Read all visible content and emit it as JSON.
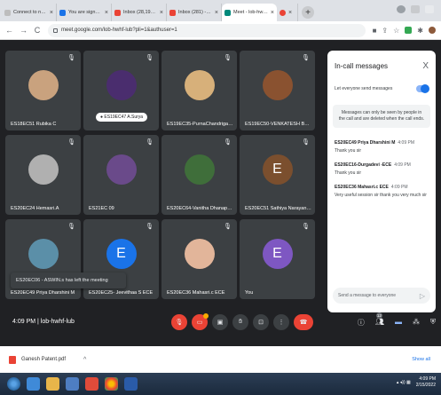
{
  "browser": {
    "tabs": [
      {
        "label": "Connect to network",
        "color": "#bdbdbd"
      },
      {
        "label": "You are signed in as es18ec17",
        "color": "#1a73e8"
      },
      {
        "label": "Inbox (28,199) - ",
        "color": "#ea4335"
      },
      {
        "label": "Inbox (281) - ecsy2@esec.ac.i",
        "color": "#ea4335"
      },
      {
        "label": "Meet - lob-hwhf-lub",
        "color": "#00897b"
      },
      {
        "label": "",
        "color": "#ea4335"
      }
    ],
    "url": "meet.google.com/lob-hwhf-lub?pli=1&authuser=1"
  },
  "participants": [
    {
      "name": "ES18EC51 Rubika C",
      "avatar_color": "#c9a27e",
      "letter": ""
    },
    {
      "name": "ES19EC47 A.Surya",
      "avatar_color": "#4a2d6e",
      "letter": "",
      "speaking": true
    },
    {
      "name": "ES19EC35-PurnaChandrigaa. R",
      "avatar_color": "#d7b07a",
      "letter": ""
    },
    {
      "name": "ES19EC50-VENKATESH BABU...",
      "avatar_color": "#8a5230",
      "letter": ""
    },
    {
      "name": "ES20EC24 Hemasri.A",
      "avatar_color": "#b0b0b0",
      "letter": ""
    },
    {
      "name": "ES21EC 09",
      "avatar_color": "#6a4a8a",
      "letter": ""
    },
    {
      "name": "ES20EC64-Vanitha Dhanapal ...",
      "avatar_color": "#3f6e3a",
      "letter": ""
    },
    {
      "name": "ES20EC51 Sathiya Narayanan t",
      "avatar_color": "#7b4f2e",
      "letter": "E"
    },
    {
      "name": "ES20EC49 Priya Dharshini M",
      "avatar_color": "#5b8fa8",
      "letter": ""
    },
    {
      "name": "ES20EC25- Jeevithaa S ECE",
      "avatar_color": "#1a73e8",
      "letter": "E"
    },
    {
      "name": "ES20EC36 Mahasri.c ECE",
      "avatar_color": "#e2b59a",
      "letter": ""
    },
    {
      "name": "You",
      "avatar_color": "#7e57c2",
      "letter": "E"
    }
  ],
  "toast": "ES20EC06 - ASWIN.s has left the meeting",
  "chat": {
    "title": "In-call messages",
    "toggle_label": "Let everyone send messages",
    "notice": "Messages can only be seen by people in the call and are deleted when the call ends.",
    "messages": [
      {
        "sender": "ES20EC49 Priya Dharshini M",
        "time": "4:09 PM",
        "text": "Thank you sir"
      },
      {
        "sender": "ES20EC16-Durgadevi -ECE",
        "time": "4:09 PM",
        "text": "Thank you sir"
      },
      {
        "sender": "ES20EC36 Mahasri.c ECE",
        "time": "4:09 PM",
        "text": "Very useful session sir thank you very much sir"
      }
    ],
    "input_placeholder": "Send a message to everyone"
  },
  "bottom": {
    "time": "4:09 PM",
    "meeting_code": "lob-hwhf-lub",
    "people_count": "12"
  },
  "downloads": {
    "file": "Ganesh Patent.pdf",
    "show_all": "Show all"
  },
  "taskbar": {
    "time": "4:09 PM",
    "date": "2/15/2022"
  }
}
